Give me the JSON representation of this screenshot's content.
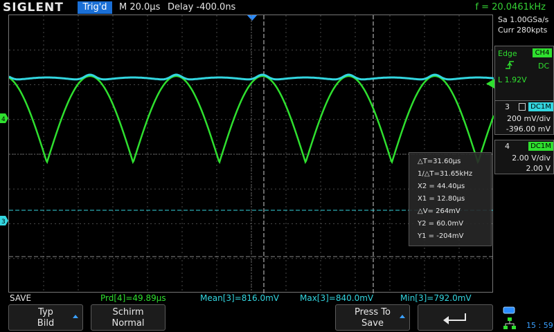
{
  "header": {
    "brand": "SIGLENT",
    "trig_status": "Trig'd",
    "timebase": "M 20.0μs",
    "delay": "Delay -400.0ns",
    "frequency": "f = 20.0461kHz"
  },
  "acquisition": {
    "sample_rate": "Sa 1.00GSa/s",
    "memory": "Curr 280kpts"
  },
  "trigger": {
    "type": "Edge",
    "source": "CH4",
    "coupling": "DC",
    "level": "L  1.92V",
    "slope_icon": "rising-edge-icon"
  },
  "channels": [
    {
      "number": "3",
      "coupling": "DC1M",
      "scale": "200 mV/div",
      "offset": "-396.00 mV",
      "color": "#33d6e0"
    },
    {
      "number": "4",
      "coupling": "DC1M",
      "scale": "2.00 V/div",
      "offset": "2.00 V",
      "color": "#2fe02f"
    }
  ],
  "cursors": {
    "delta_t": "△T=31.60μs",
    "inv_delta_t": "1/△T=31.65kHz",
    "x2": "X2 = 44.40μs",
    "x1": "X1 = 12.80μs",
    "delta_v": "△V= 264mV",
    "y2": "Y2 = 60.0mV",
    "y1": "Y1 = -204mV"
  },
  "measurements": {
    "save": "SAVE",
    "prd": "Prd[4]=49.89μs",
    "mean": "Mean[3]=816.0mV",
    "max": "Max[3]=840.0mV",
    "min": "Min[3]=792.0mV"
  },
  "softkeys": {
    "type_l1": "Typ",
    "type_l2": "Bild",
    "screen_l1": "Schirm",
    "screen_l2": "Normal",
    "press_l1": "Press To",
    "press_l2": "Save",
    "back_icon": "return-arrow-icon"
  },
  "status": {
    "time": "15 : 59"
  },
  "colors": {
    "ch3": "#33d6e0",
    "ch4": "#2fe02f",
    "accent": "#1a6fd6"
  }
}
